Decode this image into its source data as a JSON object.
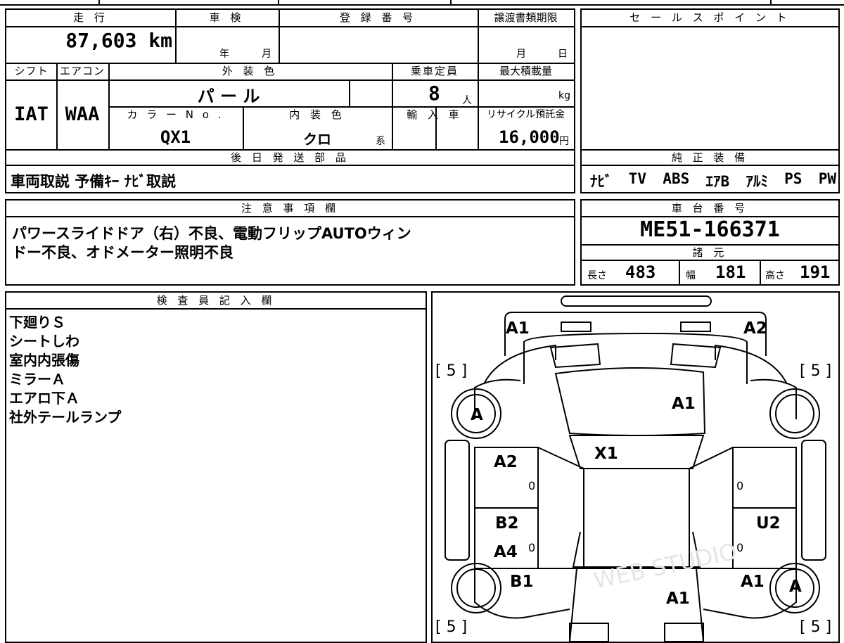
{
  "top": {
    "mileage_label": "走 行",
    "mileage_value": "87,603 km",
    "shaken_label": "車 検",
    "shaken_year": "年",
    "shaken_month": "月",
    "reg_label": "登 録 番 号",
    "transfer_label": "譲渡書類期限",
    "transfer_month": "月",
    "transfer_day": "日",
    "shift_label": "シフト",
    "shift_value": "IAT",
    "ac_label": "エアコン",
    "ac_value": "WAA",
    "exterior_label": "外 装 色",
    "exterior_value": "パ ー ル",
    "capacity_label": "乗車定員",
    "capacity_value": "8",
    "capacity_unit": "人",
    "load_label": "最大積載量",
    "load_unit": "kg",
    "color_no_label": "カ ラ ー N o .",
    "color_no_value": "QX1",
    "interior_label": "内 装 色",
    "interior_value": "クロ",
    "interior_suffix": "系",
    "import_label": "輸 入 車",
    "recycle_label": "リサイクル預託金",
    "recycle_value": "16,000",
    "recycle_unit": "円",
    "parts_label": "後 日 発 送 部 品",
    "parts_value": "車両取説 予備ｷｰ ﾅﾋﾞ取説"
  },
  "sales_point": {
    "label": "セ ー ル ス ポ イ ン ト"
  },
  "equipment": {
    "label": "純 正 装 備",
    "items": [
      "ﾅﾋﾞ",
      "TV",
      "ABS",
      "ｴｱB",
      "ｱﾙﾐ",
      "PS",
      "PW"
    ]
  },
  "notes": {
    "label": "注 意 事 項 欄",
    "line1": "パワースライドドア（右）不良、電動フリップAUTOウィン",
    "line2": "ドー不良、オドメーター照明不良"
  },
  "chassis": {
    "label": "車 台 番 号",
    "value": "ME51-166371"
  },
  "specs": {
    "label": "諸 元",
    "length_label": "長さ",
    "length_value": "483",
    "width_label": "幅",
    "width_value": "181",
    "height_label": "高さ",
    "height_value": "191"
  },
  "inspector": {
    "label": "検 査 員 記 入 欄",
    "lines": [
      "下廻りＳ",
      "シートしわ",
      "室内内張傷",
      "ミラーＡ",
      "エアロ下Ａ",
      "社外テールランプ"
    ]
  },
  "diagram": {
    "marks": {
      "front_left": "A1",
      "front_right": "A2",
      "tire_fl": "[ 5 ]",
      "tire_fr": "[ 5 ]",
      "tire_rl": "[ 5 ]",
      "tire_rr": "[ 5 ]",
      "hood": "A1",
      "wheel_fl": "A",
      "wheel_rr": "A",
      "windshield": "X1",
      "front_door_l": "A2",
      "rear_door_l_1": "B2",
      "rear_door_l_2": "A4",
      "rear_door_r": "U2",
      "rear_quarter_l": "B1",
      "rear_quarter_r": "A1",
      "rear": "A1",
      "zero_1": "0",
      "zero_2": "0",
      "zero_3": "0",
      "zero_4": "0"
    },
    "watermark": "WEB STUDIO"
  },
  "colors": {
    "line": "#000000",
    "background": "#ffffff"
  }
}
